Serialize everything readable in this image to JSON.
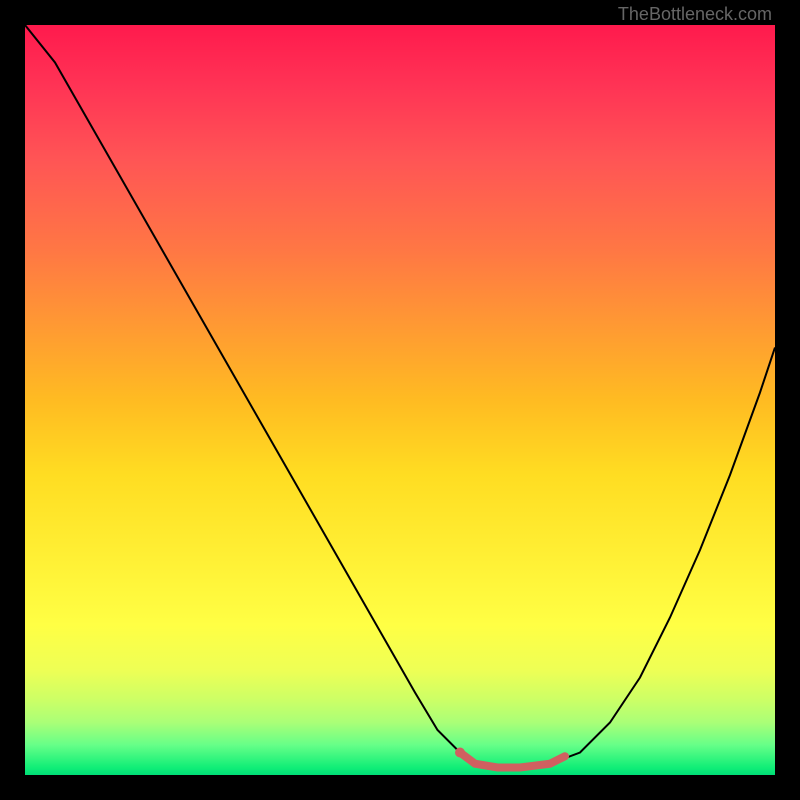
{
  "watermark": "TheBottleneck.com",
  "chart_data": {
    "type": "line",
    "title": "",
    "xlabel": "",
    "ylabel": "",
    "xlim": [
      0,
      100
    ],
    "ylim": [
      0,
      100
    ],
    "grid": false,
    "series": [
      {
        "name": "bottleneck-curve",
        "x": [
          0,
          4,
          8,
          12,
          16,
          20,
          24,
          28,
          32,
          36,
          40,
          44,
          48,
          52,
          55,
          58,
          60,
          63,
          66,
          70,
          74,
          78,
          82,
          86,
          90,
          94,
          98,
          100
        ],
        "y": [
          100,
          95,
          88,
          81,
          74,
          67,
          60,
          53,
          46,
          39,
          32,
          25,
          18,
          11,
          6,
          3,
          1.5,
          1,
          1,
          1.5,
          3,
          7,
          13,
          21,
          30,
          40,
          51,
          57
        ]
      }
    ],
    "highlight": {
      "name": "optimal-range",
      "x": [
        58,
        60,
        63,
        66,
        70,
        72
      ],
      "y": [
        3,
        1.5,
        1,
        1,
        1.5,
        2.5
      ]
    },
    "highlight_dot": {
      "x": 58,
      "y": 3
    },
    "background_gradient": {
      "top_color": "#ff1a4d",
      "mid_color": "#ffff44",
      "bottom_color": "#00dd77"
    }
  }
}
